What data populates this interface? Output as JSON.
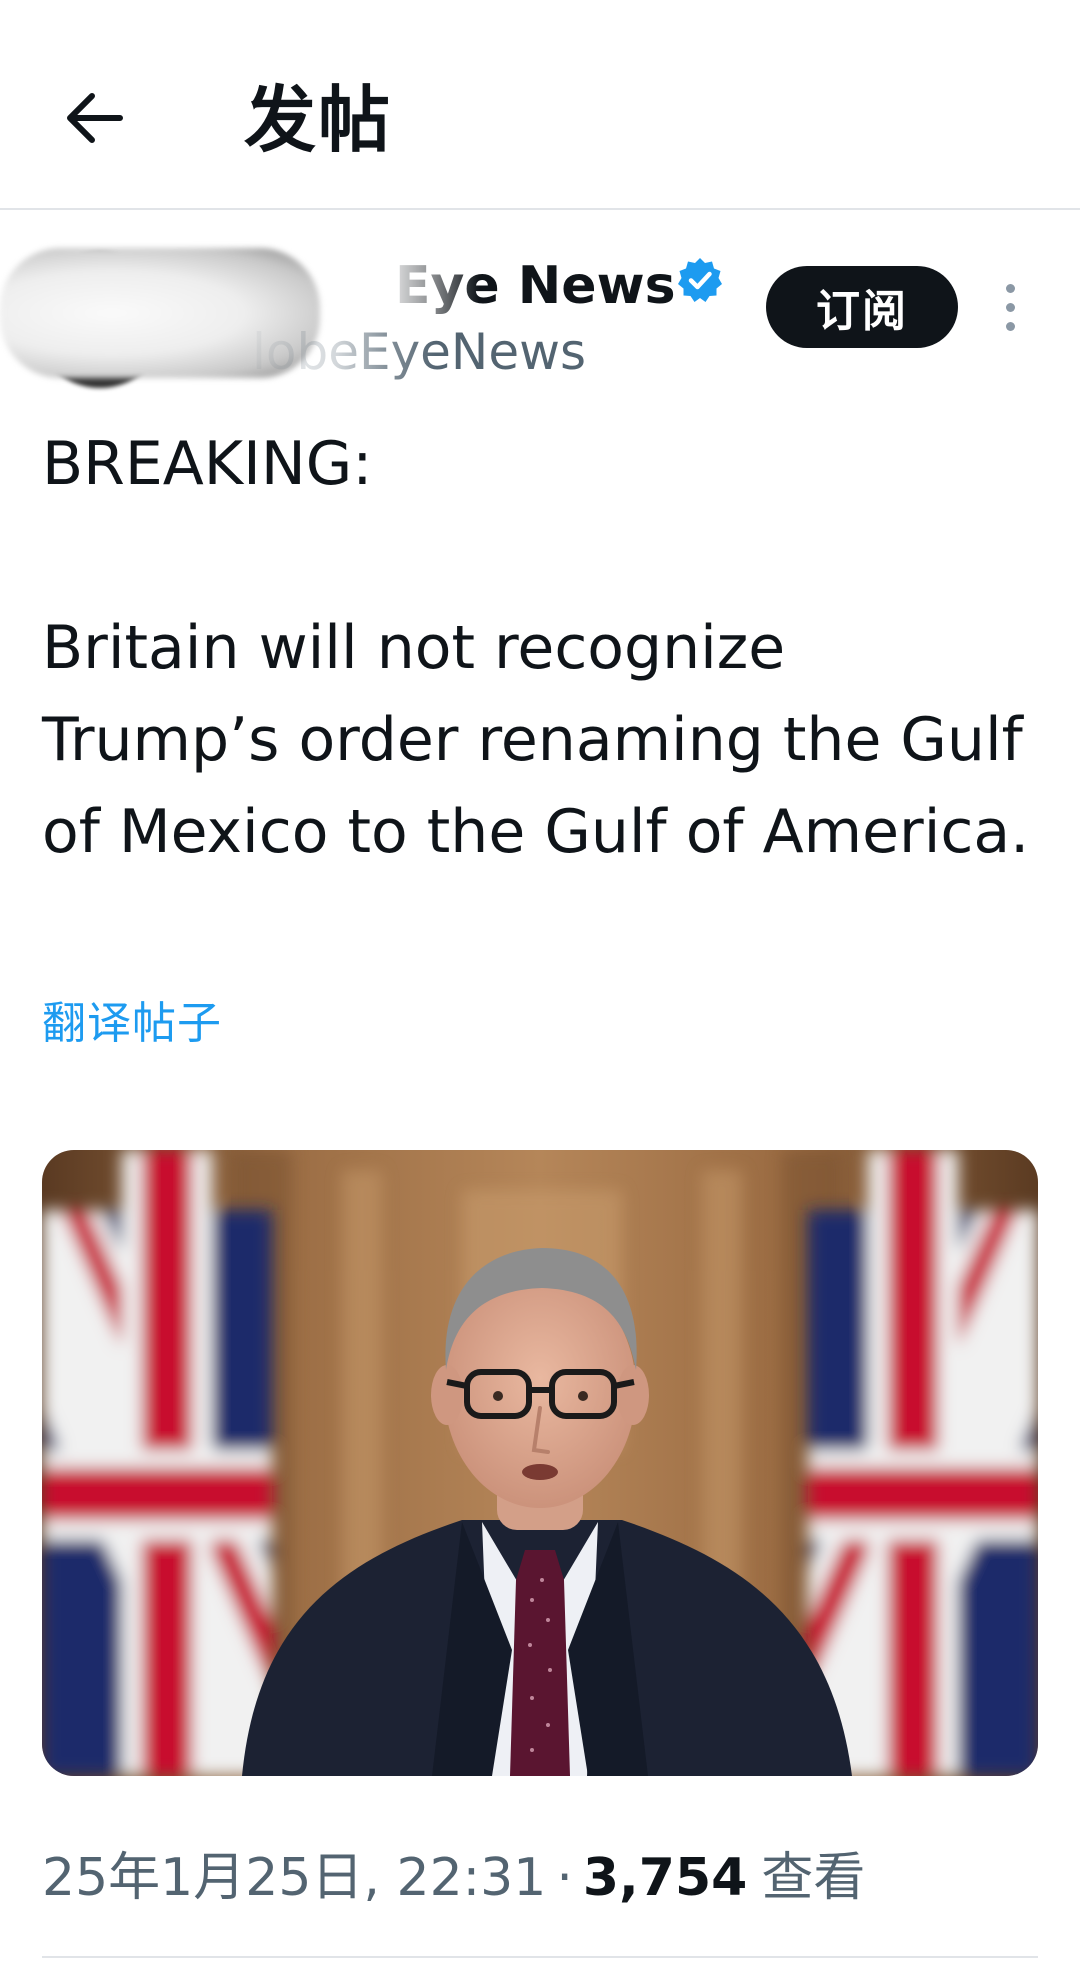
{
  "header": {
    "title": "发帖"
  },
  "author": {
    "display_name": "Eye News",
    "handle": "lobeEyeNews",
    "subscribe_label": "订阅"
  },
  "post": {
    "text": "BREAKING:\n\nBritain will not recognize Trump’s order renaming the Gulf of Mexico to the Gulf of America.",
    "translate_label": "翻译帖子"
  },
  "meta": {
    "datetime": "25年1月25日, 22:31",
    "separator": "·",
    "views_count": "3,754",
    "views_label": "查看"
  },
  "colors": {
    "accent": "#1d9bf0",
    "text_primary": "#0f1419",
    "text_secondary": "#536471",
    "divider": "#e1e4e8"
  },
  "icons": {
    "back": "arrow-left-icon",
    "verified": "verified-badge-icon",
    "more": "more-vertical-icon"
  }
}
